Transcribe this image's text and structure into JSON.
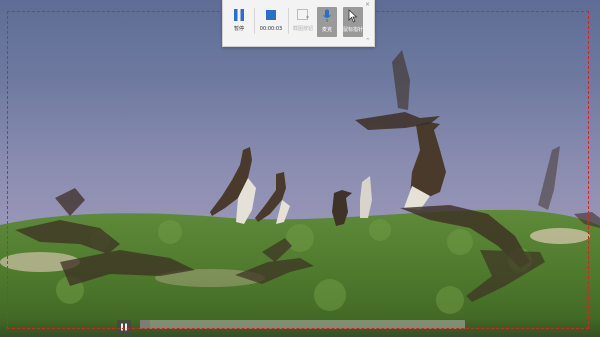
{
  "recorder_toolbar": {
    "pause_label": "暂停",
    "stop_label": "00:00:03",
    "screenshot_label": "截图按钮",
    "microphone_label": "麦克",
    "pointer_label": "鼠标指针",
    "close_glyph": "×",
    "collapse_glyph": "^"
  },
  "video_player": {
    "progress_fraction": 0.03
  },
  "colors": {
    "accent_blue": "#2d6fc8",
    "recording_border": "#e02020",
    "toolbar_bg": "#f3f3f3",
    "toggle_active_bg": "#9a9a9a"
  },
  "icons": {
    "pause": "pause-icon",
    "stop": "stop-icon",
    "screenshot": "screenshot-icon",
    "microphone": "microphone-icon",
    "pointer": "mouse-pointer-icon",
    "close": "close-icon",
    "collapse": "collapse-icon"
  }
}
